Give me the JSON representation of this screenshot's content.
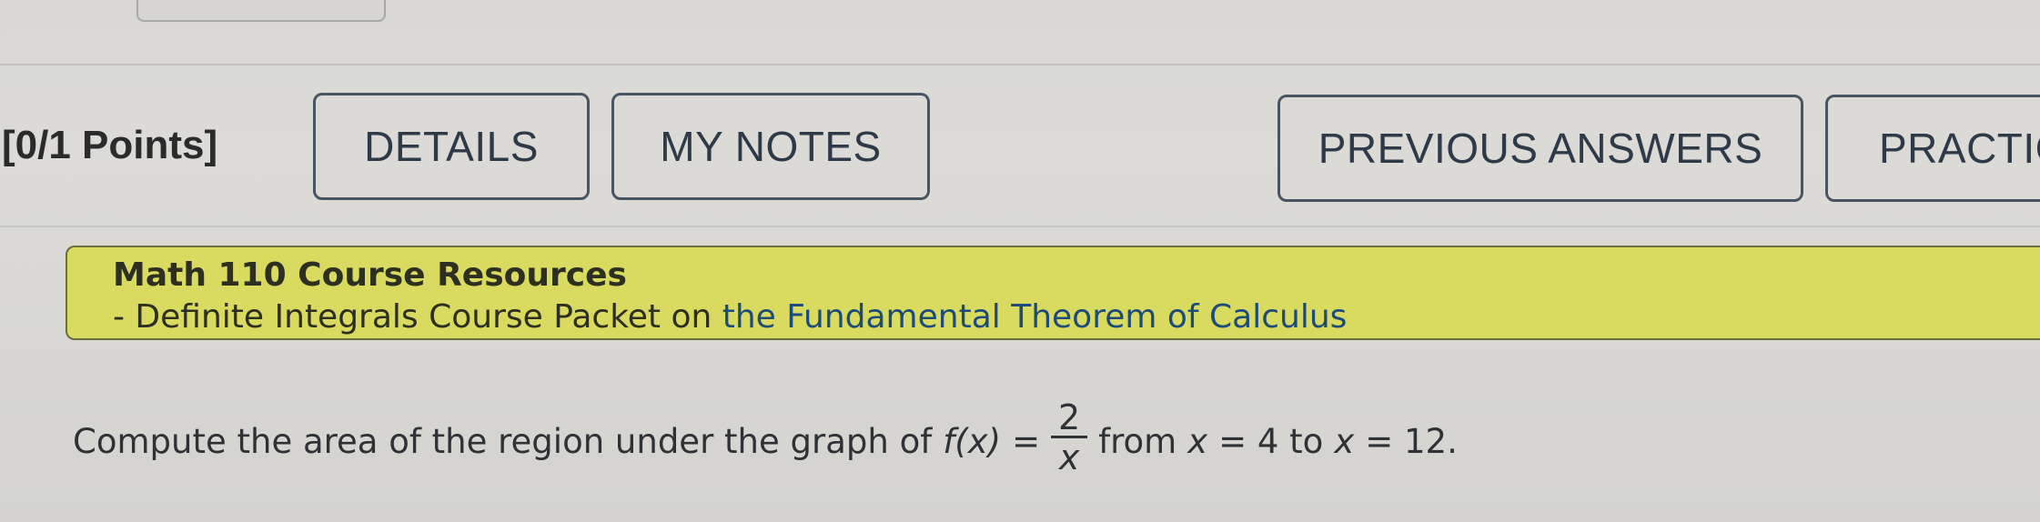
{
  "header": {
    "points_label": "[0/1 Points]"
  },
  "toolbar": {
    "details_label": "DETAILS",
    "my_notes_label": "MY NOTES",
    "previous_answers_label": "PREVIOUS ANSWERS",
    "practice_label": "PRACTIC"
  },
  "resources": {
    "title": "Math 110 Course Resources",
    "line_prefix": "- Definite Integrals Course Packet on ",
    "link_text": "the Fundamental Theorem of Calculus",
    "background_color": "#d8db5f",
    "link_color": "#1d4c7a"
  },
  "question": {
    "text_before": "Compute the area of the region under the graph of",
    "function": "f(x)",
    "equals": "=",
    "numerator": "2",
    "denominator": "x",
    "text_from": "from",
    "var_lower": "x",
    "lower_eq": "= 4 to",
    "var_upper": "x",
    "upper_eq": "= 12."
  }
}
